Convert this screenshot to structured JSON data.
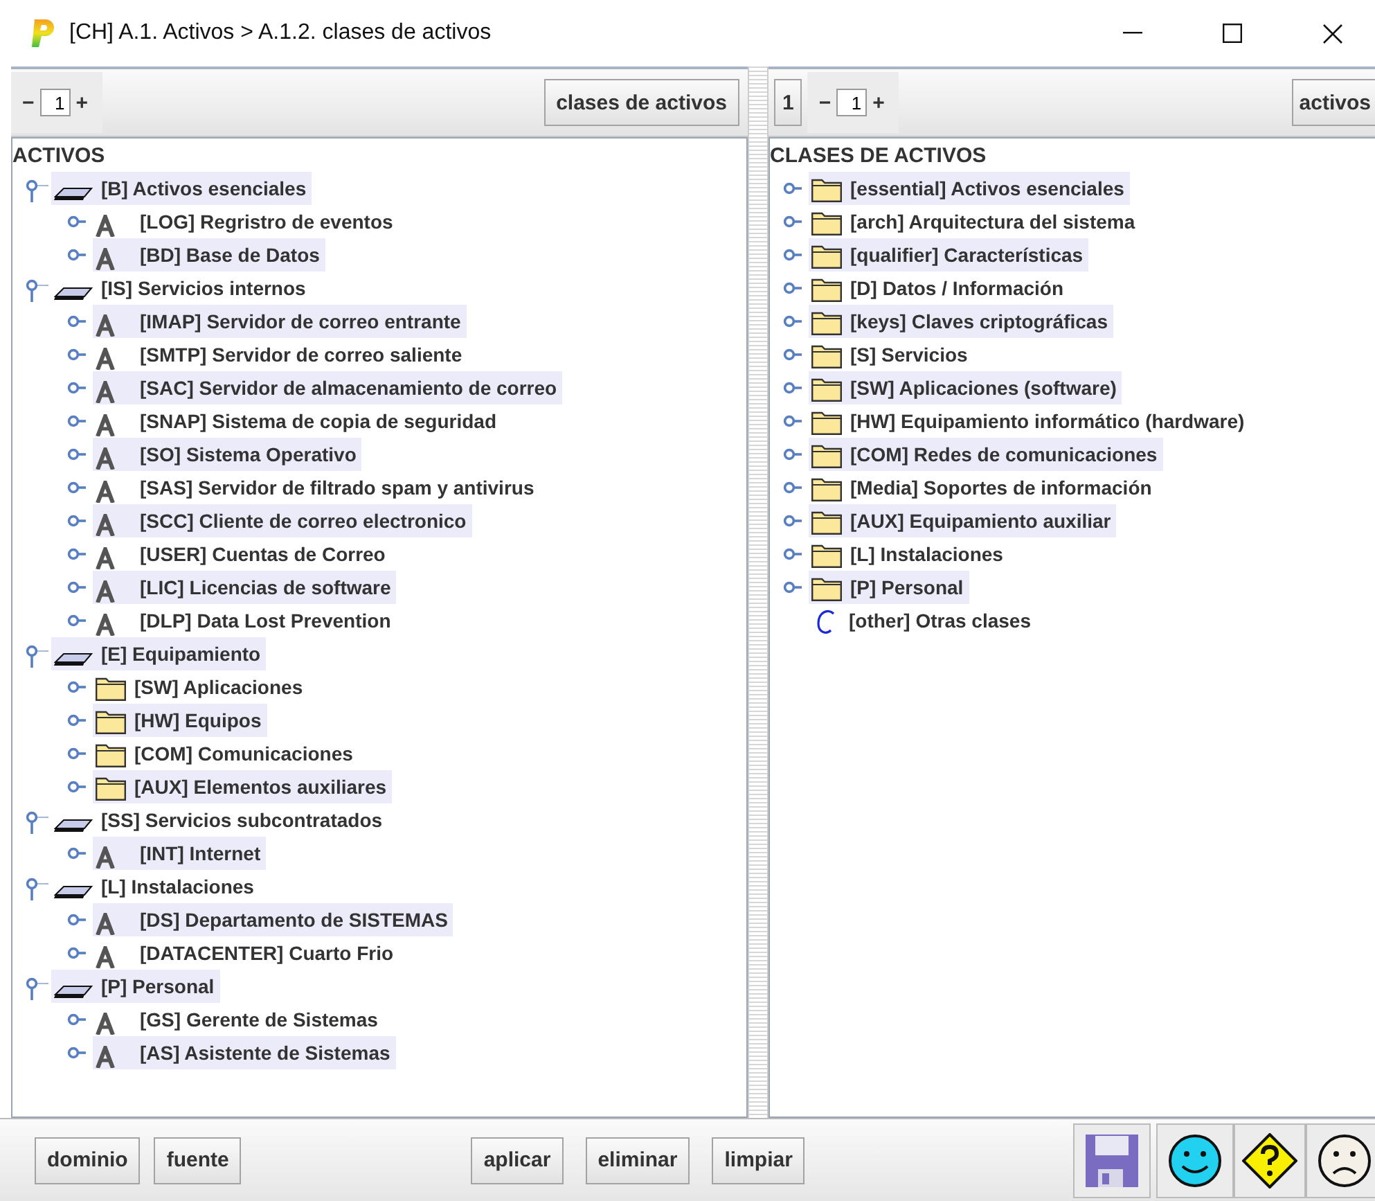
{
  "window": {
    "title": "[CH] A.1. Activos > A.1.2. clases de activos"
  },
  "left_panel": {
    "stepper": {
      "minus": "−",
      "value": "1",
      "plus": "+"
    },
    "button": "clases de activos",
    "tree": {
      "root": "ACTIVOS",
      "items": [
        {
          "kind": "layer",
          "label": "[B] Activos esenciales",
          "expanded": true,
          "children": [
            {
              "kind": "asset",
              "label": "[LOG] Regristro de eventos",
              "expanded": false
            },
            {
              "kind": "asset",
              "label": "[BD] Base de Datos",
              "expanded": false
            }
          ]
        },
        {
          "kind": "layer",
          "label": "[IS] Servicios internos",
          "expanded": true,
          "children": [
            {
              "kind": "asset",
              "label": "[IMAP] Servidor de correo entrante",
              "expanded": false
            },
            {
              "kind": "asset",
              "label": "[SMTP] Servidor de correo saliente",
              "expanded": false
            },
            {
              "kind": "asset",
              "label": "[SAC] Servidor de almacenamiento de correo",
              "expanded": false
            },
            {
              "kind": "asset",
              "label": "[SNAP] Sistema de copia de seguridad",
              "expanded": false
            },
            {
              "kind": "asset",
              "label": "[SO] Sistema Operativo",
              "expanded": false
            },
            {
              "kind": "asset",
              "label": "[SAS] Servidor de filtrado spam y antivirus",
              "expanded": false
            },
            {
              "kind": "asset",
              "label": "[SCC] Cliente de correo electronico",
              "expanded": false
            },
            {
              "kind": "asset",
              "label": "[USER] Cuentas de Correo",
              "expanded": false
            },
            {
              "kind": "asset",
              "label": "[LIC] Licencias de software",
              "expanded": false
            },
            {
              "kind": "asset",
              "label": "[DLP] Data Lost Prevention",
              "expanded": false
            }
          ]
        },
        {
          "kind": "layer",
          "label": "[E] Equipamiento",
          "expanded": true,
          "children": [
            {
              "kind": "folder",
              "label": "[SW] Aplicaciones",
              "expanded": false
            },
            {
              "kind": "folder",
              "label": "[HW] Equipos",
              "expanded": false
            },
            {
              "kind": "folder",
              "label": "[COM] Comunicaciones",
              "expanded": false
            },
            {
              "kind": "folder",
              "label": "[AUX] Elementos auxiliares",
              "expanded": false
            }
          ]
        },
        {
          "kind": "layer",
          "label": "[SS] Servicios subcontratados",
          "expanded": true,
          "children": [
            {
              "kind": "asset",
              "label": "[INT] Internet",
              "expanded": false
            }
          ]
        },
        {
          "kind": "layer",
          "label": "[L] Instalaciones",
          "expanded": true,
          "children": [
            {
              "kind": "asset",
              "label": "[DS] Departamento de SISTEMAS",
              "expanded": false
            },
            {
              "kind": "asset",
              "label": "[DATACENTER] Cuarto Frio",
              "expanded": false
            }
          ]
        },
        {
          "kind": "layer",
          "label": "[P] Personal",
          "expanded": true,
          "children": [
            {
              "kind": "asset",
              "label": "[GS] Gerente de Sistemas",
              "expanded": false
            },
            {
              "kind": "asset",
              "label": "[AS] Asistente de Sistemas",
              "expanded": false
            }
          ]
        }
      ]
    }
  },
  "right_panel": {
    "page_button": "1",
    "stepper": {
      "minus": "−",
      "value": "1",
      "plus": "+"
    },
    "button": "activos",
    "tree": {
      "root": "CLASES DE ACTIVOS",
      "items": [
        {
          "kind": "folder",
          "label": "[essential] Activos esenciales",
          "expanded": false
        },
        {
          "kind": "folder",
          "label": "[arch] Arquitectura del sistema",
          "expanded": false
        },
        {
          "kind": "folder",
          "label": "[qualifier] Características",
          "expanded": false
        },
        {
          "kind": "folder",
          "label": "[D] Datos / Información",
          "expanded": false
        },
        {
          "kind": "folder",
          "label": "[keys] Claves criptográficas",
          "expanded": false
        },
        {
          "kind": "folder",
          "label": "[S] Servicios",
          "expanded": false
        },
        {
          "kind": "folder",
          "label": "[SW] Aplicaciones (software)",
          "expanded": false
        },
        {
          "kind": "folder",
          "label": "[HW] Equipamiento informático (hardware)",
          "expanded": false
        },
        {
          "kind": "folder",
          "label": "[COM] Redes de comunicaciones",
          "expanded": false
        },
        {
          "kind": "folder",
          "label": "[Media] Soportes de información",
          "expanded": false
        },
        {
          "kind": "folder",
          "label": "[AUX] Equipamiento auxiliar",
          "expanded": false
        },
        {
          "kind": "folder",
          "label": "[L] Instalaciones",
          "expanded": false
        },
        {
          "kind": "folder",
          "label": "[P] Personal",
          "expanded": false
        },
        {
          "kind": "class",
          "label": "[other] Otras clases"
        }
      ]
    }
  },
  "bottom_bar": {
    "left_buttons": [
      "dominio",
      "fuente"
    ],
    "action_buttons": [
      "aplicar",
      "eliminar",
      "limpiar"
    ]
  }
}
